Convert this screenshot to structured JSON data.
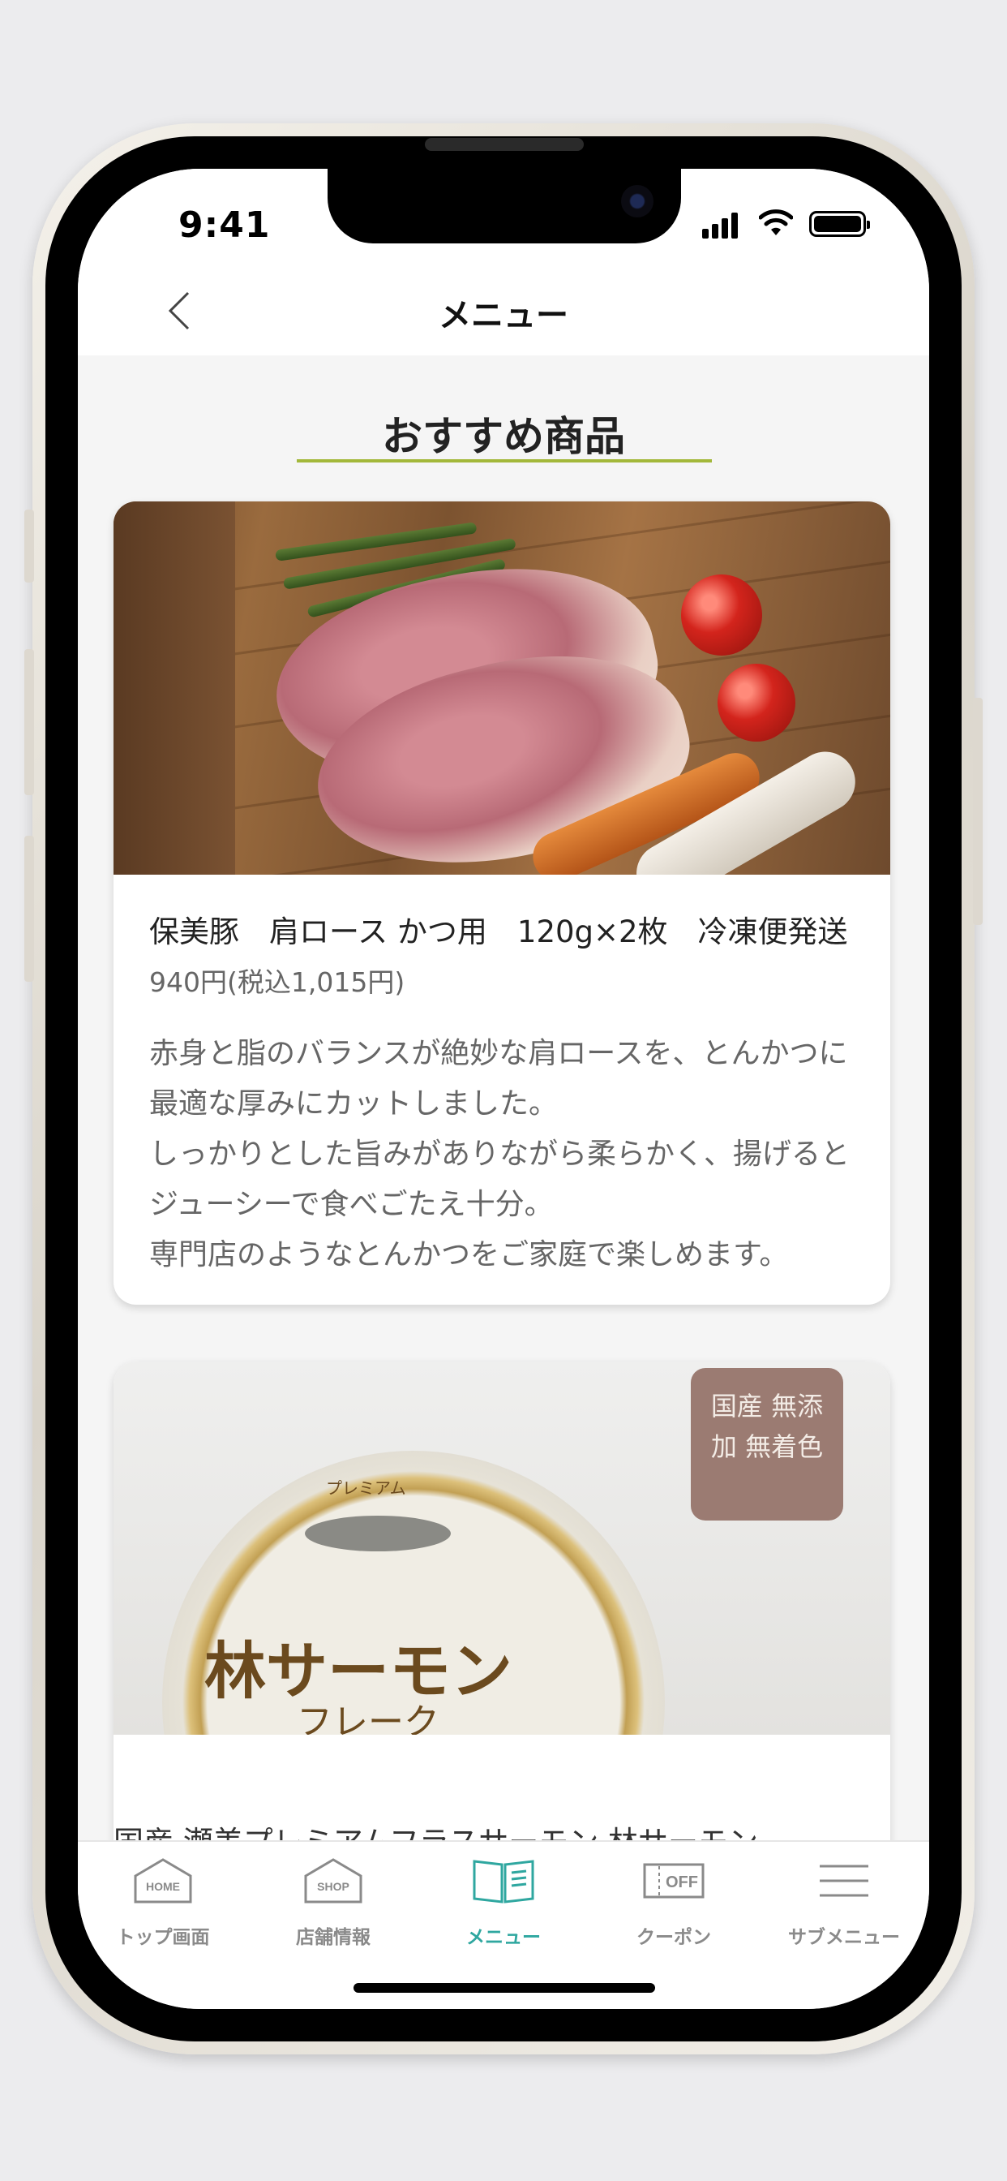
{
  "status": {
    "time": "9:41"
  },
  "nav": {
    "title": "メニュー"
  },
  "section": {
    "title": "おすすめ商品"
  },
  "products": [
    {
      "name": "保美豚　肩ロース かつ用　120g×2枚　冷凍便発送",
      "price": "940円(税込1,015円)",
      "description": "赤身と脂のバランスが絶妙な肩ロースを、とんかつに最適な厚みにカットしました。\nしっかりとした旨みがありながら柔らかく、揚げるとジューシーで食べごたえ十分。\n専門店のようなとんかつをご家庭で楽しめます。"
    },
    {
      "image_text": {
        "badge": "国産 無添加 無着色",
        "brand": "林サーモン",
        "sub": "フレーク",
        "top": "プレミアム"
      },
      "name_peek": "国産 瀬美プレミアムフラスサーモン 林サーモン"
    }
  ],
  "tabs": [
    {
      "label": "トップ画面",
      "icon": "home-icon",
      "icon_text": "HOME",
      "active": false
    },
    {
      "label": "店舗情報",
      "icon": "shop-icon",
      "icon_text": "SHOP",
      "active": false
    },
    {
      "label": "メニュー",
      "icon": "menu-book-icon",
      "active": true
    },
    {
      "label": "クーポン",
      "icon": "coupon-icon",
      "icon_text": "OFF",
      "active": false
    },
    {
      "label": "サブメニュー",
      "icon": "hamburger-icon",
      "active": false
    }
  ],
  "colors": {
    "accent": "#2fa7a0",
    "section_rule": "#a3b83a",
    "inactive": "#8a8a8a"
  }
}
